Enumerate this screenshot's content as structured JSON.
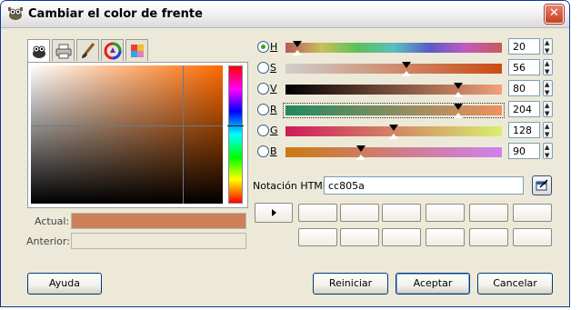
{
  "window": {
    "title": "Cambiar el color de frente"
  },
  "tabs": [
    {
      "icon": "gimp-wilber-icon",
      "active": true
    },
    {
      "icon": "printer-icon",
      "active": false
    },
    {
      "icon": "brush-icon",
      "active": false
    },
    {
      "icon": "color-wheel-icon",
      "active": false
    },
    {
      "icon": "palette-icon",
      "active": false
    }
  ],
  "swatches": {
    "current_label": "Actual:",
    "current_color": "#cc805a",
    "previous_label": "Anterior:",
    "previous_color": "#ece9d8"
  },
  "channels": [
    {
      "label": "H",
      "value": "20",
      "selected": true,
      "level": 0.055
    },
    {
      "label": "S",
      "value": "56",
      "selected": false,
      "level": 0.56
    },
    {
      "label": "V",
      "value": "80",
      "selected": false,
      "level": 0.8
    },
    {
      "label": "R",
      "value": "204",
      "selected": false,
      "level": 0.8
    },
    {
      "label": "G",
      "value": "128",
      "selected": false,
      "level": 0.5
    },
    {
      "label": "B",
      "value": "90",
      "selected": false,
      "level": 0.35
    }
  ],
  "html_notation": {
    "label": "Notación HTML:",
    "value": "cc805a"
  },
  "buttons": {
    "help": "Ayuda",
    "reset": "Reiniciar",
    "ok": "Aceptar",
    "cancel": "Cancelar"
  }
}
